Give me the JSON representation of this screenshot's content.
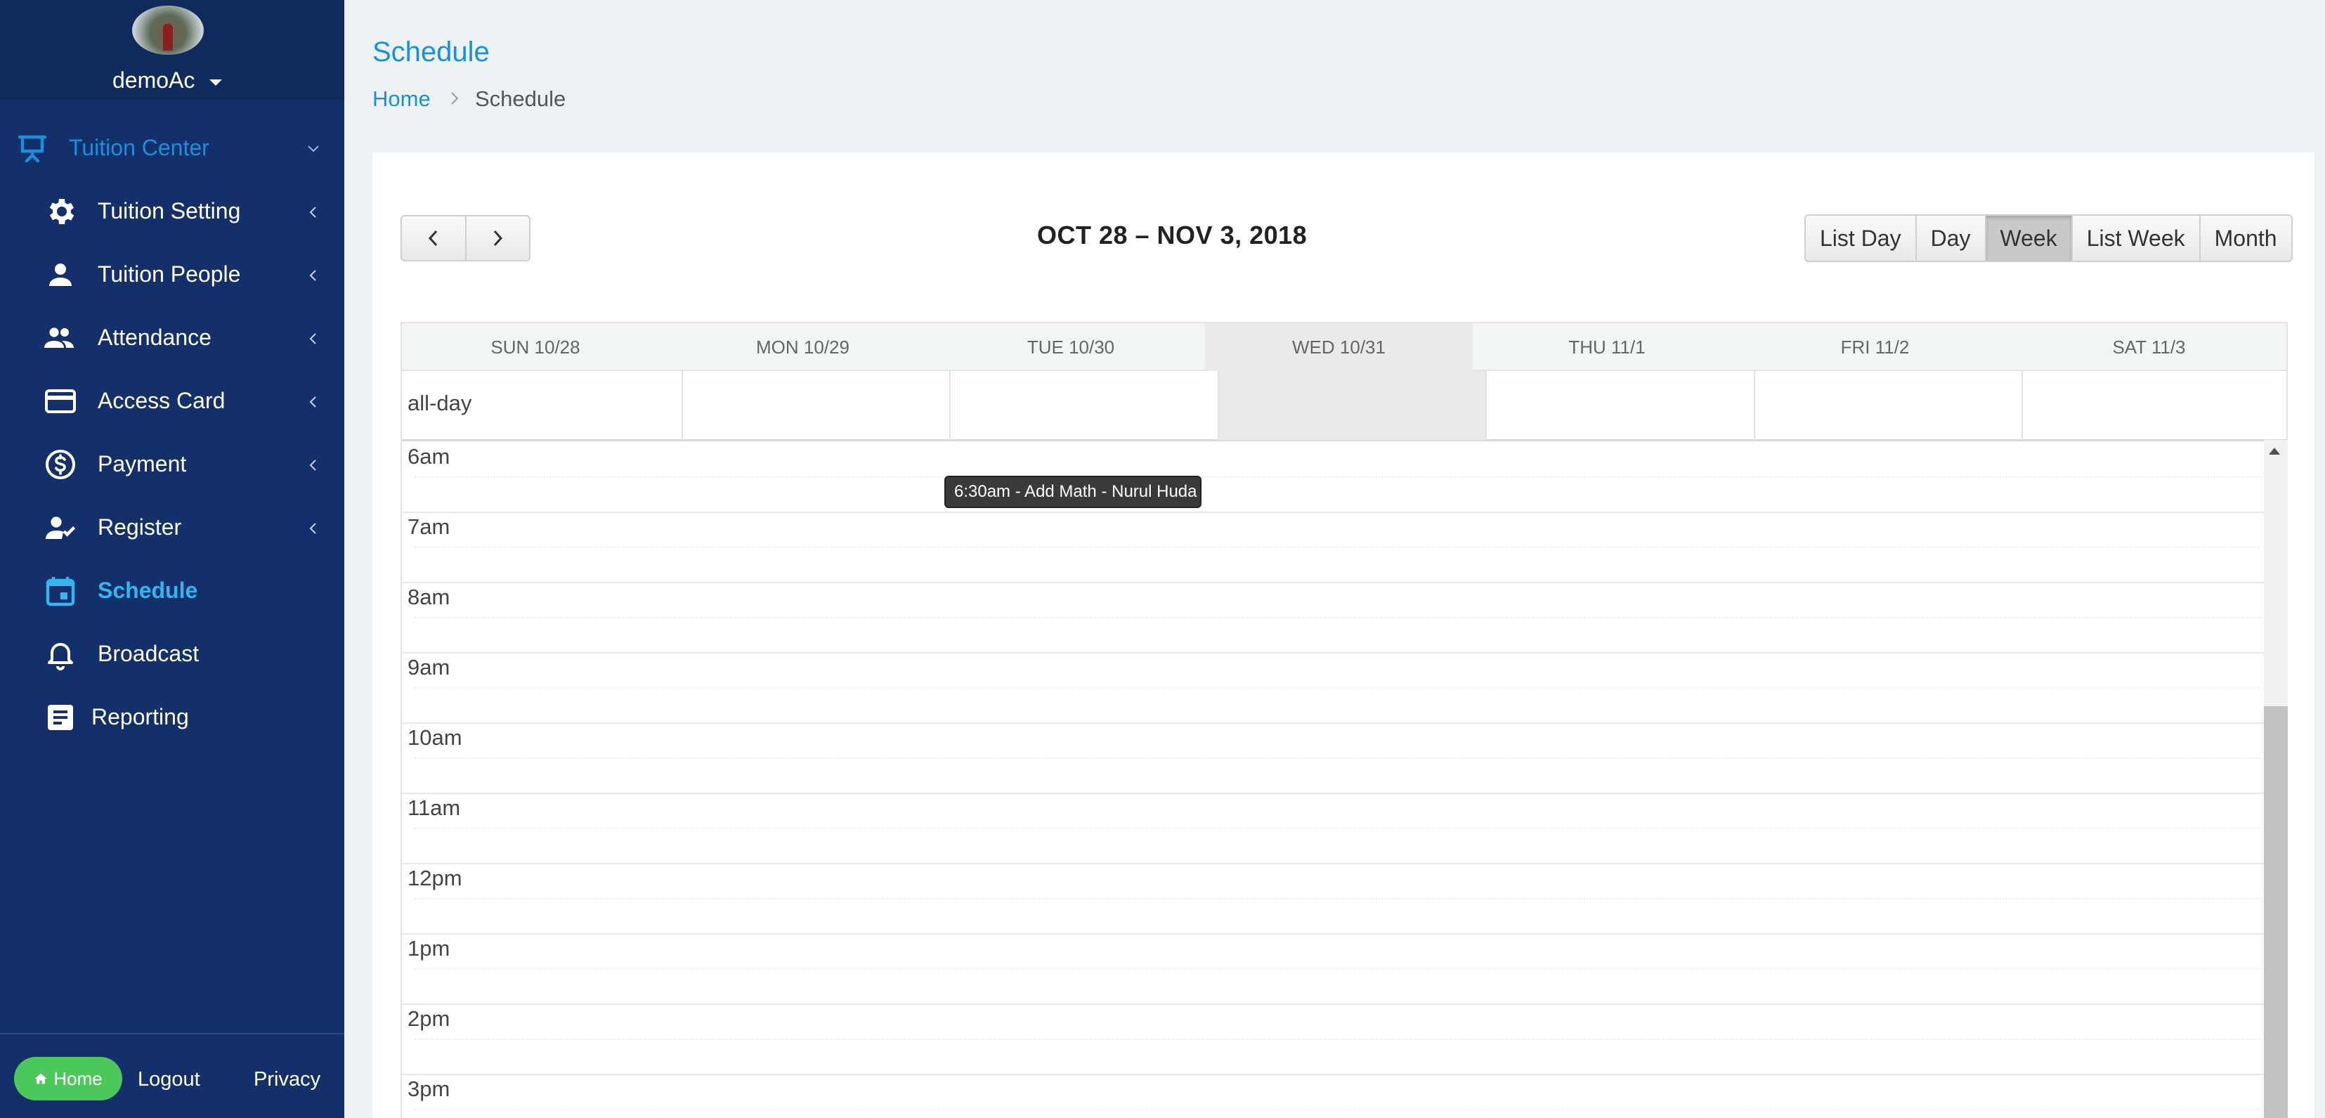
{
  "user": {
    "name": "demoAc"
  },
  "sidebar": {
    "items": [
      {
        "label": "Tuition Center",
        "icon": "presentation-board-icon"
      },
      {
        "label": "Tuition Setting",
        "icon": "gear-icon"
      },
      {
        "label": "Tuition People",
        "icon": "person-icon"
      },
      {
        "label": "Attendance",
        "icon": "people-icon"
      },
      {
        "label": "Access Card",
        "icon": "credit-card-icon"
      },
      {
        "label": "Payment",
        "icon": "dollar-circle-icon"
      },
      {
        "label": "Register",
        "icon": "person-check-icon"
      },
      {
        "label": "Schedule",
        "icon": "calendar-icon"
      },
      {
        "label": "Broadcast",
        "icon": "bell-icon"
      },
      {
        "label": "Reporting",
        "icon": "document-icon"
      }
    ],
    "footer": {
      "home": "Home",
      "logout": "Logout",
      "privacy": "Privacy"
    }
  },
  "colors": {
    "sidebar": "#14306a",
    "active": "#1a8fe0",
    "active_schedule": "#33b5f0",
    "home_button": "#4cc85b"
  },
  "page": {
    "title": "Schedule",
    "breadcrumb": [
      "Home",
      "Schedule"
    ]
  },
  "calendar": {
    "range_title": "OCT 28 – NOV 3, 2018",
    "views": [
      "List Day",
      "Day",
      "Week",
      "List Week",
      "Month"
    ],
    "active_view": "Week",
    "days": [
      "SUN 10/28",
      "MON 10/29",
      "TUE 10/30",
      "WED 10/31",
      "THU 11/1",
      "FRI 11/2",
      "SAT 11/3"
    ],
    "today": "WED 10/31",
    "all_day_label": "all-day",
    "times": [
      "6am",
      "7am",
      "8am",
      "9am",
      "10am",
      "11am",
      "12pm",
      "1pm",
      "2pm",
      "3pm"
    ],
    "event": {
      "text": "6:30am - Add Math - Nurul Huda",
      "day": "TUE 10/30",
      "start": "6:30am"
    }
  }
}
